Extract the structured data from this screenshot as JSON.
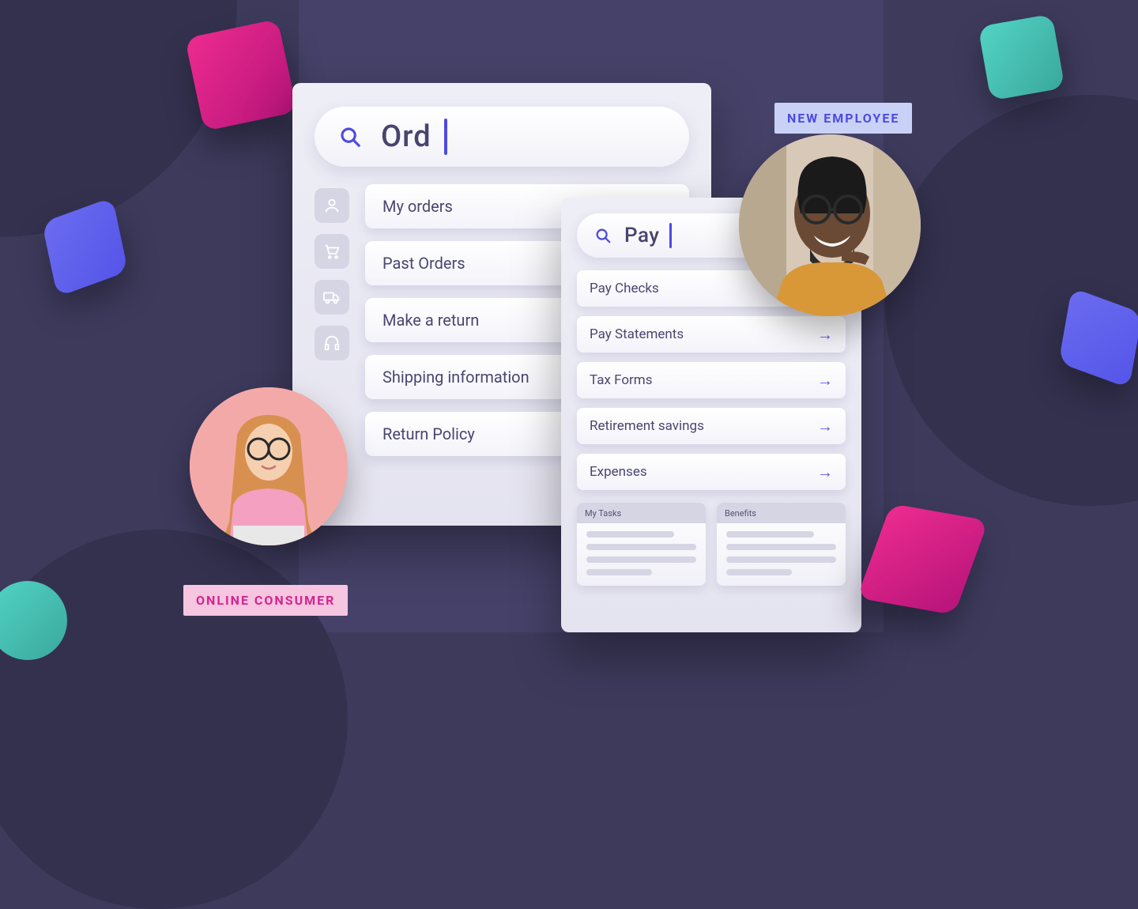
{
  "leftPanel": {
    "searchQuery": "Ord",
    "icons": [
      "person-icon",
      "cart-icon",
      "truck-icon",
      "headphones-icon"
    ],
    "results": [
      "My orders",
      "Past Orders",
      "Make a return",
      "Shipping information",
      "Return Policy"
    ]
  },
  "rightPanel": {
    "searchQuery": "Pay",
    "results": [
      {
        "label": "Pay Checks",
        "arrow": false
      },
      {
        "label": "Pay Statements",
        "arrow": true
      },
      {
        "label": "Tax Forms",
        "arrow": true
      },
      {
        "label": "Retirement savings",
        "arrow": true
      },
      {
        "label": "Expenses",
        "arrow": true
      }
    ],
    "widgets": [
      {
        "title": "My Tasks"
      },
      {
        "title": "Benefits"
      }
    ]
  },
  "badges": {
    "consumer": "ONLINE CONSUMER",
    "employee": "NEW EMPLOYEE"
  }
}
